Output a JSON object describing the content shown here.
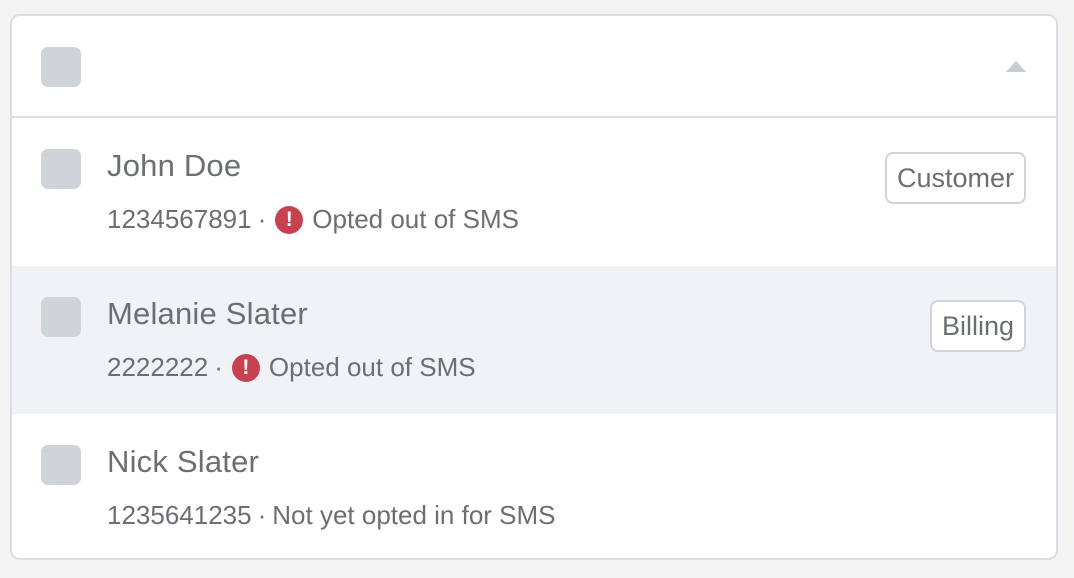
{
  "contacts": [
    {
      "name": "John Doe",
      "phone": "1234567891",
      "separator": "·",
      "status": "Opted out of SMS",
      "status_icon": "alert-circle-icon",
      "tag": "Customer"
    },
    {
      "name": "Melanie Slater",
      "phone": "2222222",
      "separator": "·",
      "status": "Opted out of SMS",
      "status_icon": "alert-circle-icon",
      "tag": "Billing"
    },
    {
      "name": "Nick Slater",
      "phone": "1235641235",
      "separator": "·",
      "status": "Not yet opted in for SMS"
    }
  ],
  "icons": {
    "warning_glyph": "!",
    "collapse": "chevron-up-icon"
  },
  "colors": {
    "warning": "#c9404e",
    "highlight_row": "#f0f2f6",
    "checkbox": "#cfd4db",
    "text": "#6b6e73"
  }
}
